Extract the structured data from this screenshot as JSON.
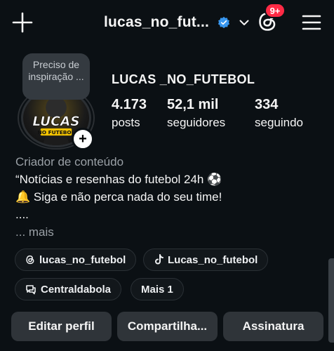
{
  "header": {
    "username": "lucas_no_fut...",
    "notifications_badge": "9+",
    "icons": [
      "plus-icon",
      "verified-badge-icon",
      "chevron-down-icon",
      "threads-icon",
      "hamburger-menu-icon"
    ]
  },
  "note": {
    "text": "Preciso de inspiração ..."
  },
  "avatar": {
    "logo_line1": "LUCAS",
    "logo_line2": "NO FUTEBOL"
  },
  "profile": {
    "name": "LUCAS _NO_FUTEBOL",
    "stats": [
      {
        "value": "4.173",
        "label": "posts"
      },
      {
        "value": "52,1 mil",
        "label": "seguidores"
      },
      {
        "value": "334",
        "label": "seguindo"
      }
    ],
    "category": "Criador de conteúdo",
    "bio_lines": [
      "“Notícias e resenhas do futebol 24h ⚽",
      "🔔 Siga e não perca nada do seu time!",
      "...."
    ],
    "more_label": "... mais"
  },
  "links": [
    {
      "label": "lucas_no_futebol",
      "icon": "threads-icon"
    },
    {
      "label": "Lucas_no_futebol",
      "icon": "tiktok-icon"
    },
    {
      "label": "Centraldabola",
      "icon": "chat-bubble-icon"
    },
    {
      "label": "Mais 1",
      "icon": ""
    }
  ],
  "actions": {
    "edit_profile": "Editar perfil",
    "share": "Compartilha...",
    "subscription": "Assinatura"
  },
  "colors": {
    "background": "#0b1014",
    "badge": "#ff2a45",
    "verified": "#3897f0",
    "button": "#2f3439"
  }
}
